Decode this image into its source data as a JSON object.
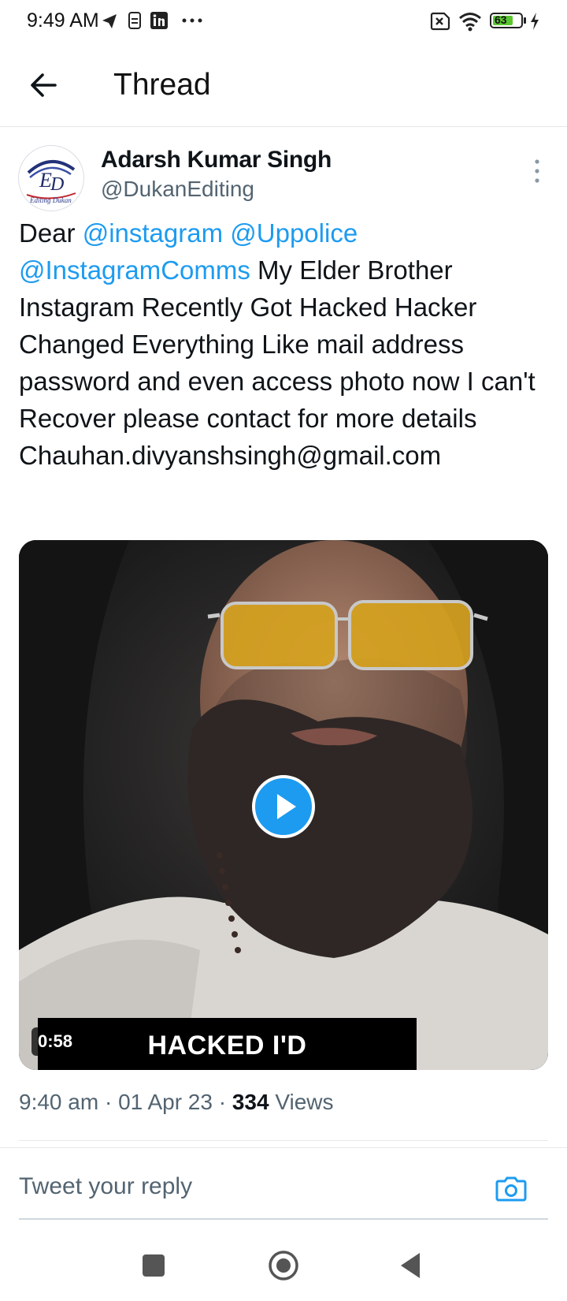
{
  "status_bar": {
    "time": "9:49 AM",
    "battery_level": "63",
    "icons": [
      "telegram-icon",
      "sim-icon",
      "linkedin-icon",
      "more-dots-icon",
      "no-sim-icon",
      "wifi-icon",
      "battery-icon",
      "charging-icon"
    ]
  },
  "header": {
    "title": "Thread"
  },
  "tweet": {
    "author_name": "Adarsh Kumar Singh",
    "author_handle": "@DukanEditing",
    "text_prefix": "Dear ",
    "mention_1": "@instagram",
    "mention_2": "@Uppolice",
    "mention_3": "@InstagramComms",
    "text_body": " My Elder Brother Instagram Recently Got Hacked Hacker Changed Everything Like mail address password and even access photo now I can't Recover please contact for more details  Chauhan.divyanshsingh@gmail.com",
    "media": {
      "duration": "0:58",
      "caption": "HACKED I'D"
    },
    "time": "9:40 am",
    "date": "01 Apr 23",
    "views_count": "334",
    "views_label": "Views"
  },
  "reply": {
    "placeholder": "Tweet your reply"
  },
  "colors": {
    "accent": "#1d9bf0",
    "text": "#0f1419",
    "secondary": "#536471"
  }
}
